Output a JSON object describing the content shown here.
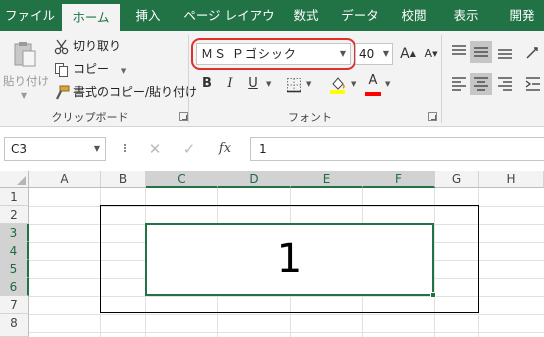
{
  "tabs": [
    {
      "label": "ファイル"
    },
    {
      "label": "ホーム"
    },
    {
      "label": "挿入"
    },
    {
      "label": "ページ レイアウト"
    },
    {
      "label": "数式"
    },
    {
      "label": "データ"
    },
    {
      "label": "校閲"
    },
    {
      "label": "表示"
    },
    {
      "label": "開発"
    }
  ],
  "active_tab": "ホーム",
  "clipboard": {
    "paste_label": "貼り付け",
    "cut_label": "切り取り",
    "copy_label": "コピー",
    "format_painter_label": "書式のコピー/貼り付け",
    "group_label": "クリップボード"
  },
  "font": {
    "font_name": "ＭＳ Ｐゴシック",
    "font_size": "40",
    "group_label": "フォント",
    "bold_glyph": "B",
    "italic_glyph": "I",
    "underline_glyph": "U",
    "font_color_glyph": "A",
    "grow_glyph": "A",
    "shrink_glyph": "A"
  },
  "formula_bar": {
    "name_box": "C3",
    "fx_label": "fx",
    "value": "1"
  },
  "columns": [
    "A",
    "B",
    "C",
    "D",
    "E",
    "F",
    "G",
    "H"
  ],
  "rows": [
    "1",
    "2",
    "3",
    "4",
    "5",
    "6",
    "7",
    "8"
  ],
  "selected_columns": [
    "C",
    "D",
    "E",
    "F"
  ],
  "selected_rows": [
    "3",
    "4",
    "5",
    "6"
  ],
  "cell": {
    "address": "C3",
    "value": "1"
  },
  "colors": {
    "accent": "#217346",
    "highlight_ring": "#e0302a",
    "fill_color": "#ffff00",
    "font_color": "#ff0000"
  }
}
